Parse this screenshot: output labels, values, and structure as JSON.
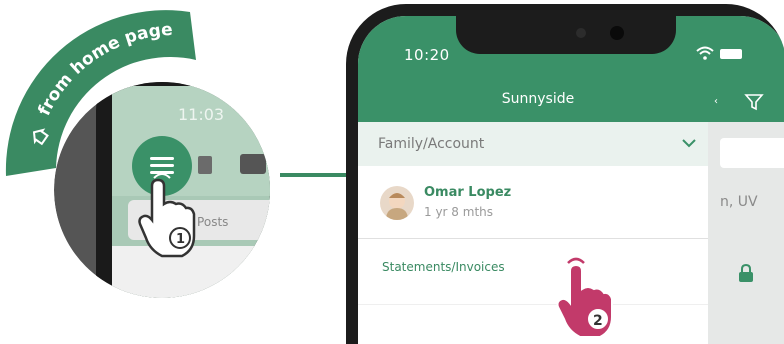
{
  "banner": {
    "text": "from home page",
    "color": "#3a8a62"
  },
  "zoom": {
    "time": "11:03",
    "search_placeholder": "Search Posts",
    "step": "1"
  },
  "phone": {
    "status_time": "10:20",
    "title": "Sunnyside",
    "menu": {
      "family_account_label": "Family/Account",
      "child": {
        "name": "Omar Lopez",
        "age": "1 yr 8 mths"
      },
      "statements_label": "Statements/Invoices"
    },
    "background_text": "n, UV"
  },
  "step2": "2",
  "colors": {
    "brand_green": "#3a9168",
    "hand_pink": "#c23a6a"
  },
  "icons": [
    "hamburger-icon",
    "filter-icon",
    "chevron-down-icon",
    "lock-icon",
    "wifi-icon",
    "battery-icon",
    "home-icon",
    "hand-tap-icon"
  ]
}
